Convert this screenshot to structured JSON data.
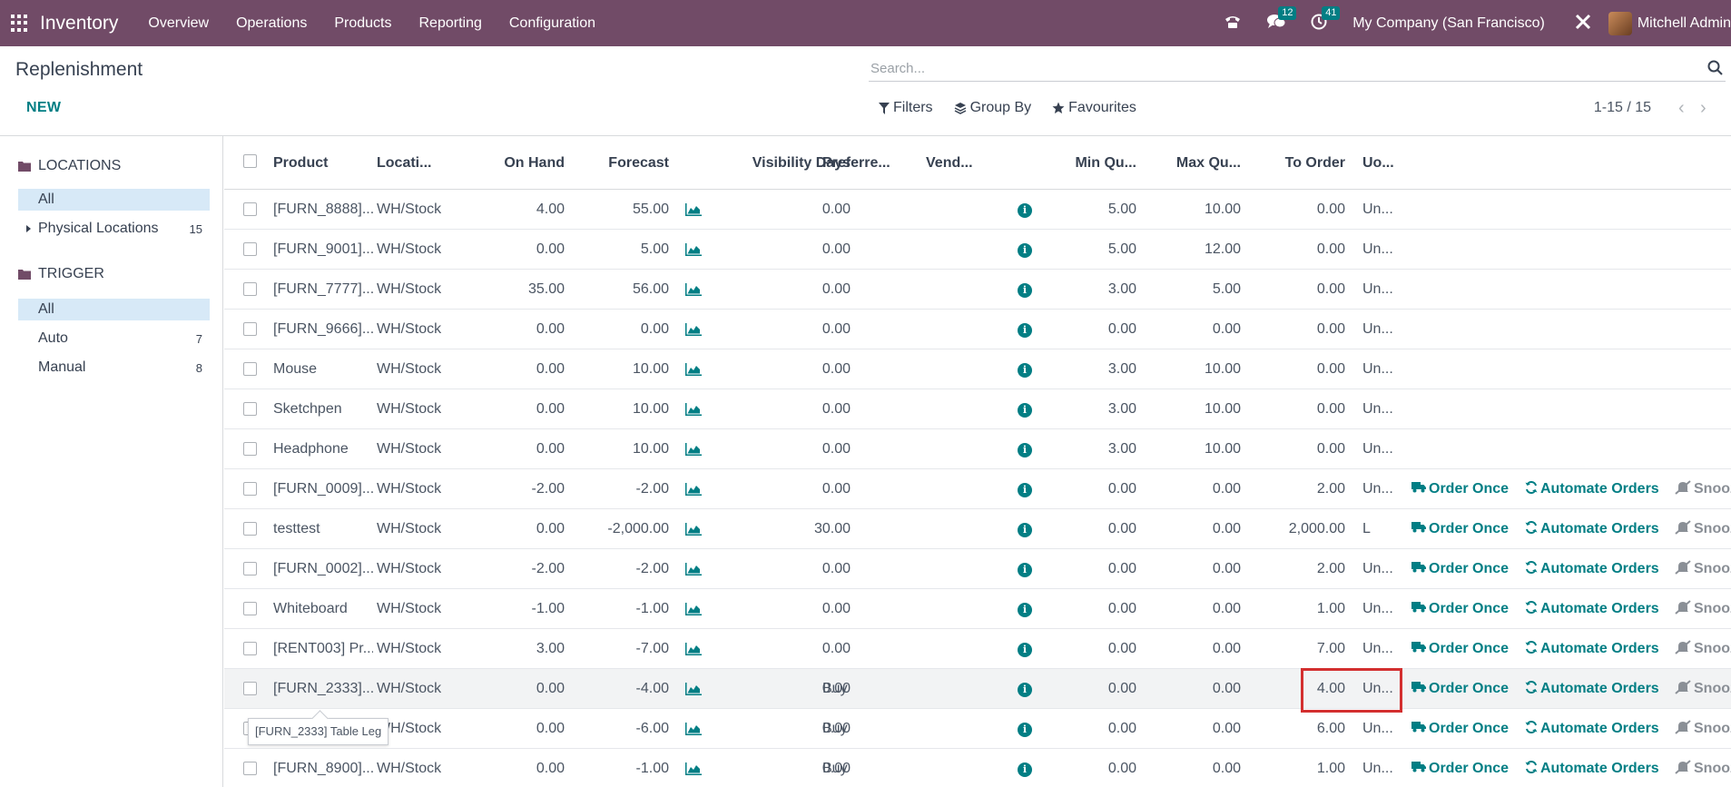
{
  "navbar": {
    "app_name": "Inventory",
    "menus": [
      "Overview",
      "Operations",
      "Products",
      "Reporting",
      "Configuration"
    ],
    "chat_count": "12",
    "activity_count": "41",
    "company": "My Company (San Francisco)",
    "user": "Mitchell Admin",
    "bg_color": "#714B67"
  },
  "control": {
    "title": "Replenishment",
    "new_label": "NEW",
    "search_placeholder": "Search...",
    "filters_label": "Filters",
    "groupby_label": "Group By",
    "favourites_label": "Favourites",
    "pager": "1-15 / 15"
  },
  "sidebar": {
    "locations_title": "LOCATIONS",
    "locations_all": "All",
    "physical_label": "Physical Locations",
    "physical_count": "15",
    "trigger_title": "TRIGGER",
    "trigger_all": "All",
    "auto_label": "Auto",
    "auto_count": "7",
    "manual_label": "Manual",
    "manual_count": "8"
  },
  "table": {
    "columns": [
      "Product",
      "Locati...",
      "On Hand",
      "Forecast",
      "Visibility Days",
      "Preferre...",
      "Vend...",
      "Min Qu...",
      "Max Qu...",
      "To Order",
      "Uo..."
    ],
    "actions": {
      "order_once": "Order Once",
      "automate": "Automate Orders",
      "snooze": "Snooz"
    },
    "rows": [
      {
        "product": "[FURN_8888]...",
        "location": "WH/Stock",
        "on_hand": "4.00",
        "forecast": "55.00",
        "visibility": "0.00",
        "route": "",
        "min": "5.00",
        "max": "10.00",
        "to_order": "0.00",
        "uom": "Un..."
      },
      {
        "product": "[FURN_9001]...",
        "location": "WH/Stock",
        "on_hand": "0.00",
        "forecast": "5.00",
        "visibility": "0.00",
        "route": "",
        "min": "5.00",
        "max": "12.00",
        "to_order": "0.00",
        "uom": "Un..."
      },
      {
        "product": "[FURN_7777]...",
        "location": "WH/Stock",
        "on_hand": "35.00",
        "forecast": "56.00",
        "visibility": "0.00",
        "route": "",
        "min": "3.00",
        "max": "5.00",
        "to_order": "0.00",
        "uom": "Un..."
      },
      {
        "product": "[FURN_9666]...",
        "location": "WH/Stock",
        "on_hand": "0.00",
        "forecast": "0.00",
        "visibility": "0.00",
        "route": "",
        "min": "0.00",
        "max": "0.00",
        "to_order": "0.00",
        "uom": "Un..."
      },
      {
        "product": "Mouse",
        "location": "WH/Stock",
        "on_hand": "0.00",
        "forecast": "10.00",
        "visibility": "0.00",
        "route": "",
        "min": "3.00",
        "max": "10.00",
        "to_order": "0.00",
        "uom": "Un..."
      },
      {
        "product": "Sketchpen",
        "location": "WH/Stock",
        "on_hand": "0.00",
        "forecast": "10.00",
        "visibility": "0.00",
        "route": "",
        "min": "3.00",
        "max": "10.00",
        "to_order": "0.00",
        "uom": "Un..."
      },
      {
        "product": "Headphone",
        "location": "WH/Stock",
        "on_hand": "0.00",
        "forecast": "10.00",
        "visibility": "0.00",
        "route": "",
        "min": "3.00",
        "max": "10.00",
        "to_order": "0.00",
        "uom": "Un..."
      },
      {
        "product": "[FURN_0009]...",
        "location": "WH/Stock",
        "on_hand": "-2.00",
        "forecast": "-2.00",
        "visibility": "0.00",
        "route": "",
        "min": "0.00",
        "max": "0.00",
        "to_order": "2.00",
        "uom": "Un..."
      },
      {
        "product": "testtest",
        "location": "WH/Stock",
        "on_hand": "0.00",
        "forecast": "-2,000.00",
        "visibility": "30.00",
        "route": "",
        "min": "0.00",
        "max": "0.00",
        "to_order": "2,000.00",
        "uom": "L"
      },
      {
        "product": "[FURN_0002]...",
        "location": "WH/Stock",
        "on_hand": "-2.00",
        "forecast": "-2.00",
        "visibility": "0.00",
        "route": "",
        "min": "0.00",
        "max": "0.00",
        "to_order": "2.00",
        "uom": "Un..."
      },
      {
        "product": "Whiteboard",
        "location": "WH/Stock",
        "on_hand": "-1.00",
        "forecast": "-1.00",
        "visibility": "0.00",
        "route": "",
        "min": "0.00",
        "max": "0.00",
        "to_order": "1.00",
        "uom": "Un..."
      },
      {
        "product": "[RENT003] Pr...",
        "location": "WH/Stock",
        "on_hand": "3.00",
        "forecast": "-7.00",
        "visibility": "0.00",
        "route": "",
        "min": "0.00",
        "max": "0.00",
        "to_order": "7.00",
        "uom": "Un..."
      },
      {
        "product": "[FURN_2333]...",
        "location": "WH/Stock",
        "on_hand": "0.00",
        "forecast": "-4.00",
        "visibility": "0.00",
        "route": "Buy",
        "min": "0.00",
        "max": "0.00",
        "to_order": "4.00",
        "uom": "Un..."
      },
      {
        "product": "",
        "location": "WH/Stock",
        "on_hand": "0.00",
        "forecast": "-6.00",
        "visibility": "0.00",
        "route": "Buy",
        "min": "0.00",
        "max": "0.00",
        "to_order": "6.00",
        "uom": "Un..."
      },
      {
        "product": "[FURN_8900]...",
        "location": "WH/Stock",
        "on_hand": "0.00",
        "forecast": "-1.00",
        "visibility": "0.00",
        "route": "Buy",
        "min": "0.00",
        "max": "0.00",
        "to_order": "1.00",
        "uom": "Un..."
      }
    ]
  },
  "tooltip": "[FURN_2333] Table Leg",
  "colors": {
    "accent": "#017e84",
    "highlight": "#d32f2f"
  }
}
